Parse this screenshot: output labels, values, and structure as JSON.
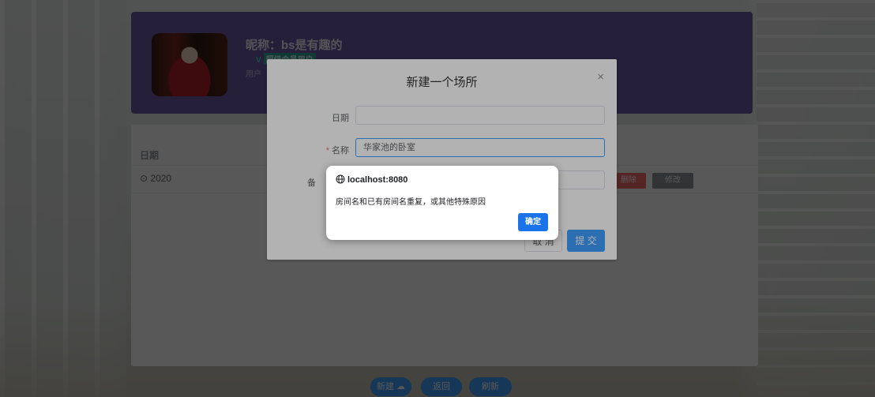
{
  "profile": {
    "nickname": "昵称：bs是有趣的",
    "vip_prefix": "V",
    "vip_text": "超级会员用户",
    "uid": "用户"
  },
  "table": {
    "header_date": "日期",
    "row_date": "⊙ 2020",
    "delete_label": "删除",
    "edit_label": "修改"
  },
  "bottom_buttons": {
    "new_label": "新建 ☁",
    "back_label": "返回",
    "refresh_label": "刷新"
  },
  "dialog": {
    "title": "新建一个场所",
    "close_symbol": "×",
    "date_label": "日期",
    "date_value": "",
    "name_required": "*",
    "name_label": "名称",
    "name_value": "华家池的卧室",
    "note_label": "备",
    "cancel_label": "取 消",
    "submit_label": "提 交"
  },
  "alert": {
    "origin": "localhost:8080",
    "message": "房间名和已有房间名重复，或其他特殊原因",
    "ok_label": "确定",
    "icon": "globe-icon"
  },
  "colors": {
    "profile_bg": "#6a5aa8",
    "primary": "#409eff",
    "danger": "#f56c6c",
    "alert_button": "#1a73e8"
  }
}
